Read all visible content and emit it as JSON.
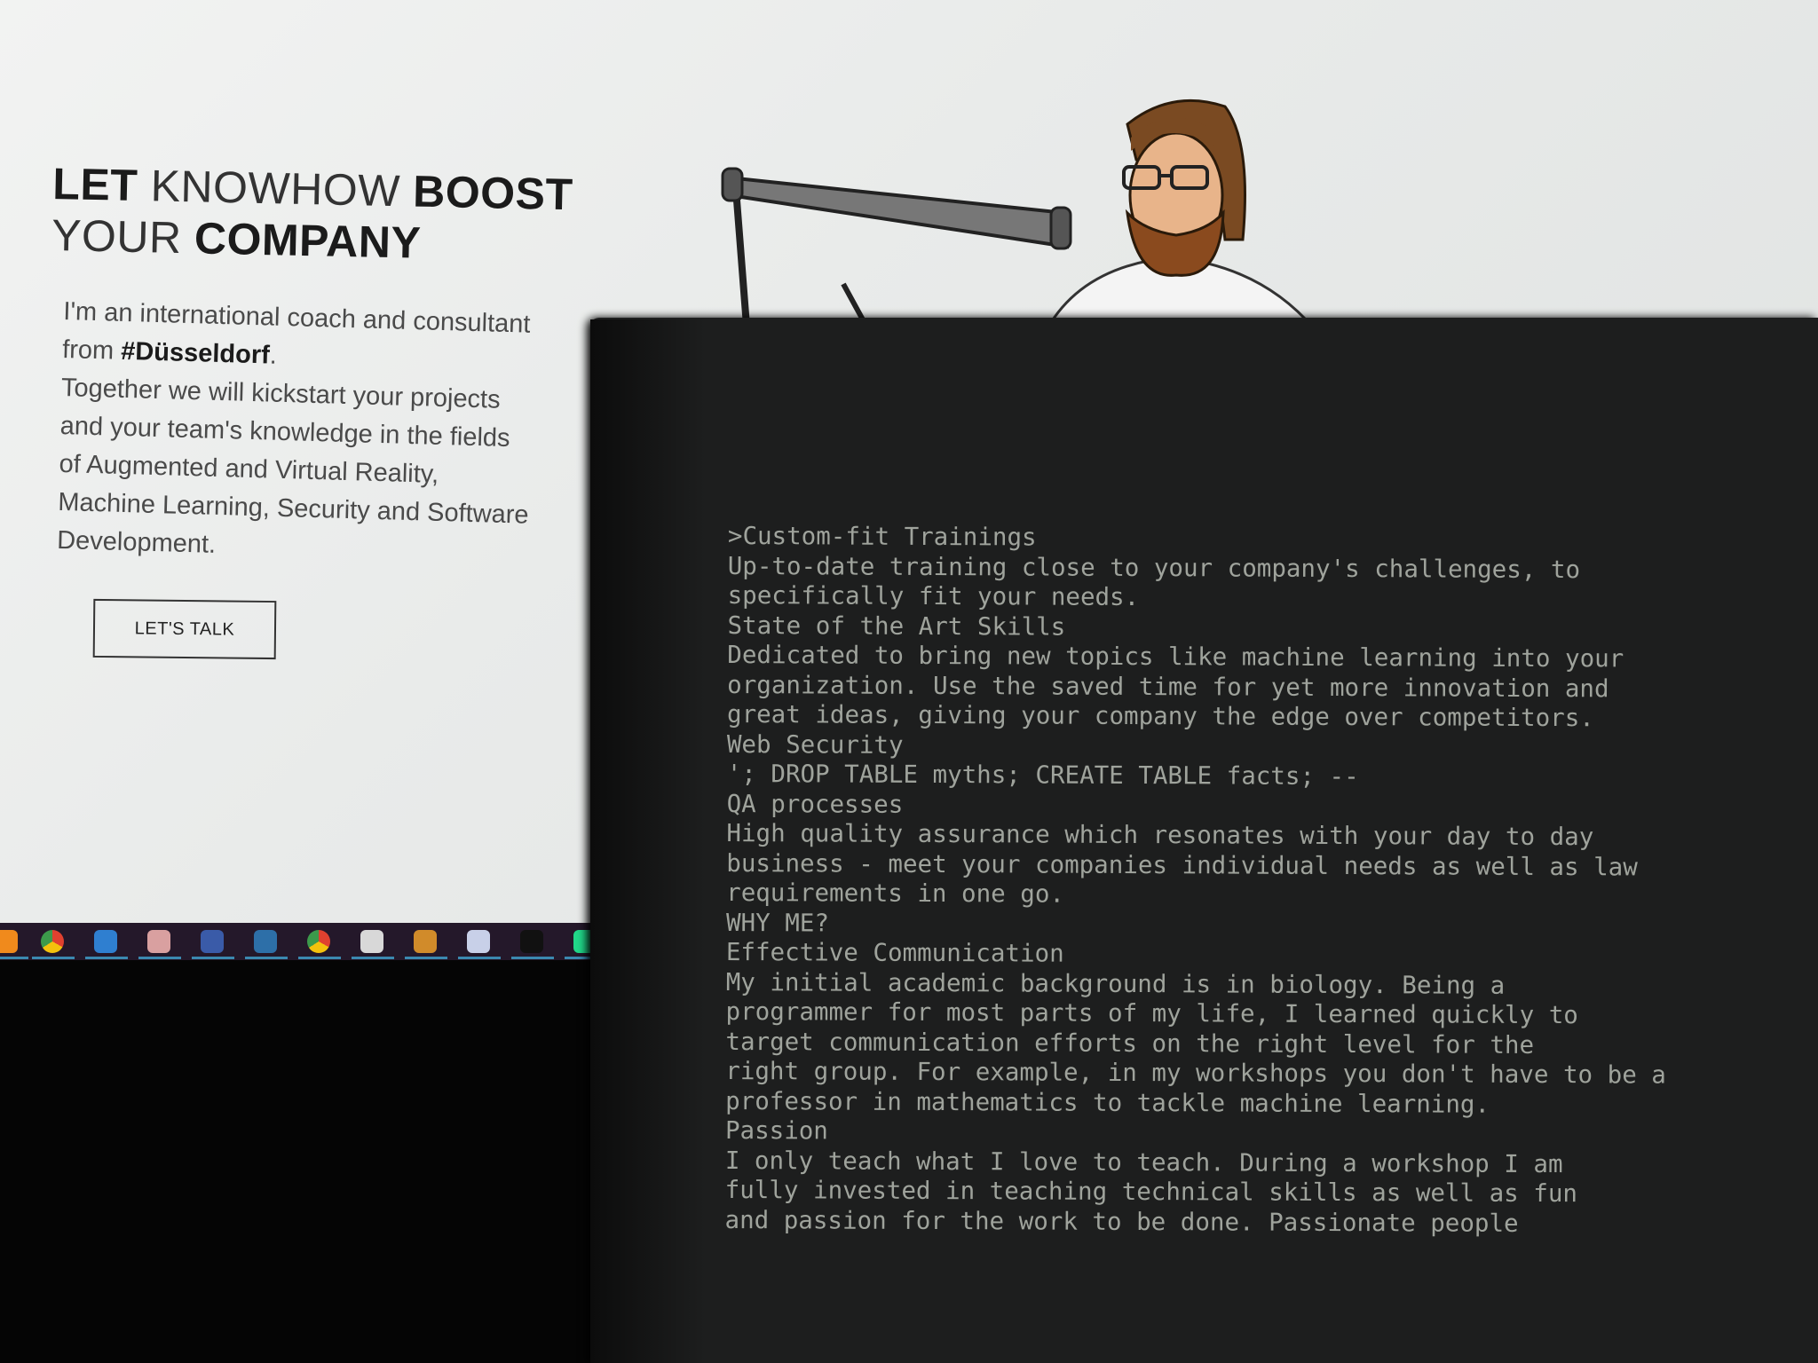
{
  "website": {
    "heading": {
      "line1": [
        {
          "text": "LET",
          "bold": true
        },
        {
          "text": " KNOWHOW ",
          "bold": false
        },
        {
          "text": "BOOST",
          "bold": true
        }
      ],
      "line2": [
        {
          "text": "YOUR ",
          "bold": false
        },
        {
          "text": "COMPANY",
          "bold": true
        }
      ]
    },
    "intro": {
      "line1": "I'm an international coach and consultant",
      "line2_prefix": "from ",
      "line2_bold": "#Düsseldorf",
      "line2_suffix": ".",
      "lines": [
        "Together we will kickstart your projects",
        "and your team's knowledge in the fields",
        "of Augmented and Virtual Reality,",
        "Machine Learning, Security and Software",
        "Development."
      ]
    },
    "cta_label": "LET'S TALK"
  },
  "taskbar": {
    "icons": [
      {
        "name": "firefox-icon",
        "color": "#f08a1c"
      },
      {
        "name": "chrome-icon",
        "color": "#3c9a4b"
      },
      {
        "name": "thunderbird-icon",
        "color": "#2f7fd0"
      },
      {
        "name": "snipping-tool-icon",
        "color": "#d9a0a0"
      },
      {
        "name": "keepass-icon",
        "color": "#3a5ba8"
      },
      {
        "name": "steam-icon",
        "color": "#2d6fa8"
      },
      {
        "name": "chrome-icon",
        "color": "#e0412f"
      },
      {
        "name": "app-icon",
        "color": "#d8d8d8"
      },
      {
        "name": "sublime-text-icon",
        "color": "#d18b2a"
      },
      {
        "name": "paint-icon",
        "color": "#c8d0e8"
      },
      {
        "name": "terminal-icon",
        "color": "#111111"
      },
      {
        "name": "pycharm-icon",
        "color": "#21d789"
      }
    ]
  },
  "terminal": {
    "lines": [
      ">Custom-fit Trainings",
      "Up-to-date training close to your company's challenges, to",
      "specifically fit your needs.",
      "State of the Art Skills",
      "Dedicated to bring new topics like machine learning into your",
      "organization. Use the saved time for yet more innovation and",
      "great ideas, giving your company the edge over competitors.",
      "Web Security",
      "'; DROP TABLE myths; CREATE TABLE facts; --",
      "QA processes",
      "High quality assurance which resonates with your day to day",
      "business - meet your companies individual needs as well as law",
      "requirements in one go.",
      "WHY ME?",
      "Effective Communication",
      "My initial academic background is in biology. Being a",
      "programmer for most parts of my life, I learned quickly to",
      "target communication efforts on the right level for the",
      "right group. For example, in my workshops you don't have to be a",
      "professor in mathematics to tackle machine learning.",
      "Passion",
      "I only teach what I love to teach. During a workshop I am",
      "fully invested in teaching technical skills as well as fun",
      "and passion for the work to be done. Passionate people"
    ]
  }
}
